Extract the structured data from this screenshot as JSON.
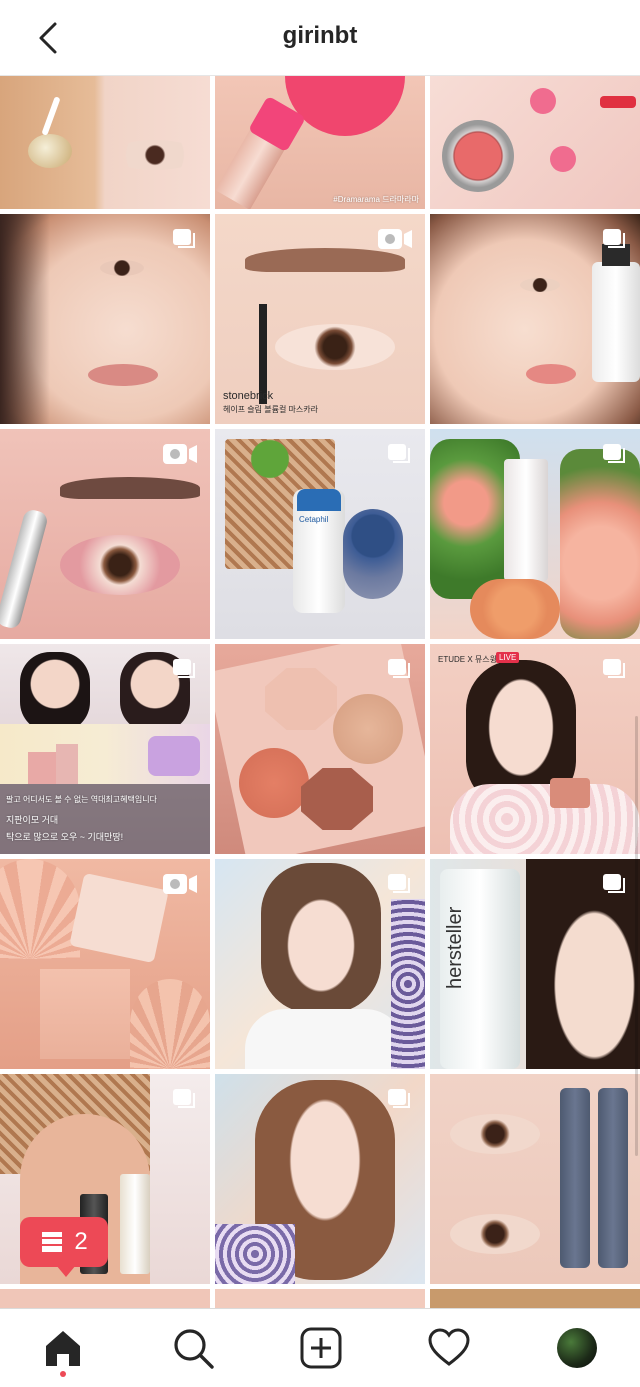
{
  "header": {
    "title": "girinbt"
  },
  "captions": {
    "dramarama": "#Dramarama 드라마라마",
    "stonebrick": "stonebrick",
    "stonebrick_sub": "헤이프 슬림 볼륨컬 마스카라",
    "live_text1": "팔고 어디서도 볼 수 없는 역대최고혜택입니다",
    "live_text2": "지판이모 거대",
    "live_text3": "탁으로 많으로 오우 ~ 기대만땅!",
    "etude": "ETUDE X 뮤스윙",
    "live_badge": "LIVE",
    "hersteller": "hersteller",
    "cetaphil": "Cetaphil"
  },
  "notification": {
    "count": "2"
  },
  "colors": {
    "accent": "#ed4956",
    "text": "#262626"
  }
}
